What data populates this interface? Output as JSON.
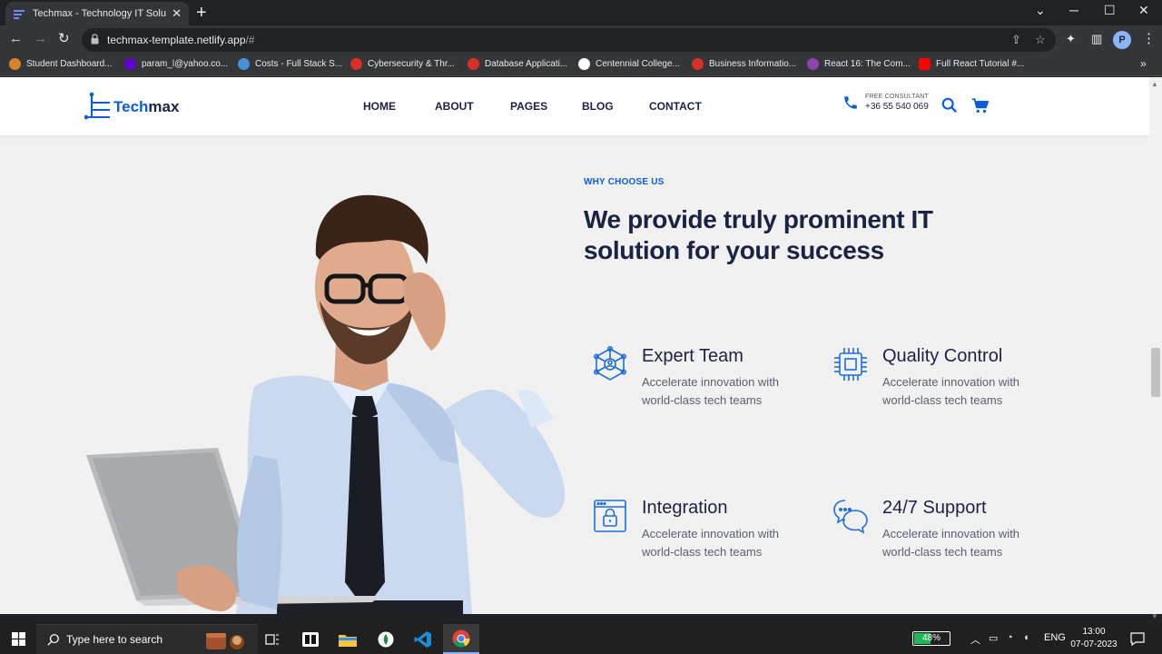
{
  "browser": {
    "tab_title": "Techmax - Technology IT Solution",
    "url_main": "techmax-template.netlify.app",
    "url_rest": "/#",
    "profile_initial": "P",
    "bookmarks": [
      "Student Dashboard...",
      "param_l@yahoo.co...",
      "Costs - Full Stack S...",
      "Cybersecurity & Thr...",
      "Database Applicati...",
      "Centennial College...",
      "Business Informatio...",
      "React 16: The Com...",
      "Full React Tutorial #..."
    ]
  },
  "site": {
    "logo_prefix": "Tech",
    "logo_suffix": "max",
    "nav": [
      "HOME",
      "ABOUT",
      "PAGES",
      "BLOG",
      "CONTACT"
    ],
    "consult_label": "FREE CONSULTANT",
    "consult_phone": "+36 55 540 069",
    "accent_color": "#0b5ed7",
    "heading_color": "#1b2343"
  },
  "section": {
    "eyebrow": "WHY CHOOSE US",
    "headline": "We provide truly prominent IT solution for your success",
    "features": [
      {
        "title": "Expert Team",
        "desc": "Accelerate innovation with world-class tech teams",
        "icon": "network-team-icon"
      },
      {
        "title": "Quality Control",
        "desc": "Accelerate innovation with world-class tech teams",
        "icon": "chip-icon"
      },
      {
        "title": "Integration",
        "desc": "Accelerate innovation with world-class tech teams",
        "icon": "lock-window-icon"
      },
      {
        "title": "24/7 Support",
        "desc": "Accelerate innovation with world-class tech teams",
        "icon": "chat-support-icon"
      }
    ]
  },
  "taskbar": {
    "search_placeholder": "Type here to search",
    "battery": "48%",
    "battery_level": 0.48,
    "language": "ENG",
    "time": "13:00",
    "date": "07-07-2023"
  }
}
